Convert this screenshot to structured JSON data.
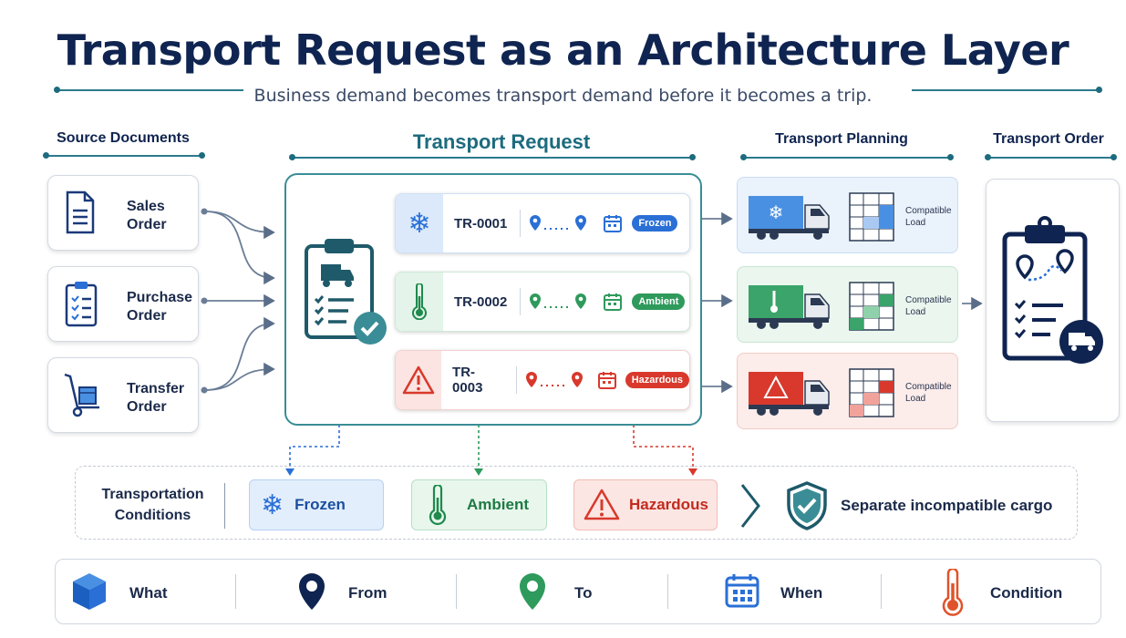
{
  "title": "Transport Request as an Architecture Layer",
  "subtitle": "Business demand becomes transport demand before it becomes a trip.",
  "columns": {
    "source": "Source Documents",
    "request": "Transport Request",
    "planning": "Transport Planning",
    "order": "Transport Order"
  },
  "source_documents": [
    {
      "line1": "Sales",
      "line2": "Order"
    },
    {
      "line1": "Purchase",
      "line2": "Order"
    },
    {
      "line1": "Transfer",
      "line2": "Order"
    }
  ],
  "requests": [
    {
      "id": "TR-0001",
      "condition": "Frozen",
      "color": "#2a6fd6"
    },
    {
      "id": "TR-0002",
      "condition": "Ambient",
      "color": "#2e9a5c"
    },
    {
      "id": "TR-0003",
      "condition": "Hazardous",
      "color": "#d8392c"
    }
  ],
  "planning": [
    {
      "line1": "Compatible",
      "line2": "Load"
    },
    {
      "line1": "Compatible",
      "line2": "Load"
    },
    {
      "line1": "Compatible",
      "line2": "Load"
    }
  ],
  "conditions": {
    "label_line1": "Transportation",
    "label_line2": "Conditions",
    "frozen": "Frozen",
    "ambient": "Ambient",
    "hazardous": "Hazardous",
    "separate": "Separate incompatible cargo"
  },
  "legend": {
    "what": "What",
    "from": "From",
    "to": "To",
    "when": "When",
    "condition": "Condition"
  },
  "colors": {
    "navy": "#0f2450",
    "teal": "#3a8d96",
    "frozen": "#2a6fd6",
    "ambient": "#2e9a5c",
    "hazardous": "#d8392c"
  }
}
